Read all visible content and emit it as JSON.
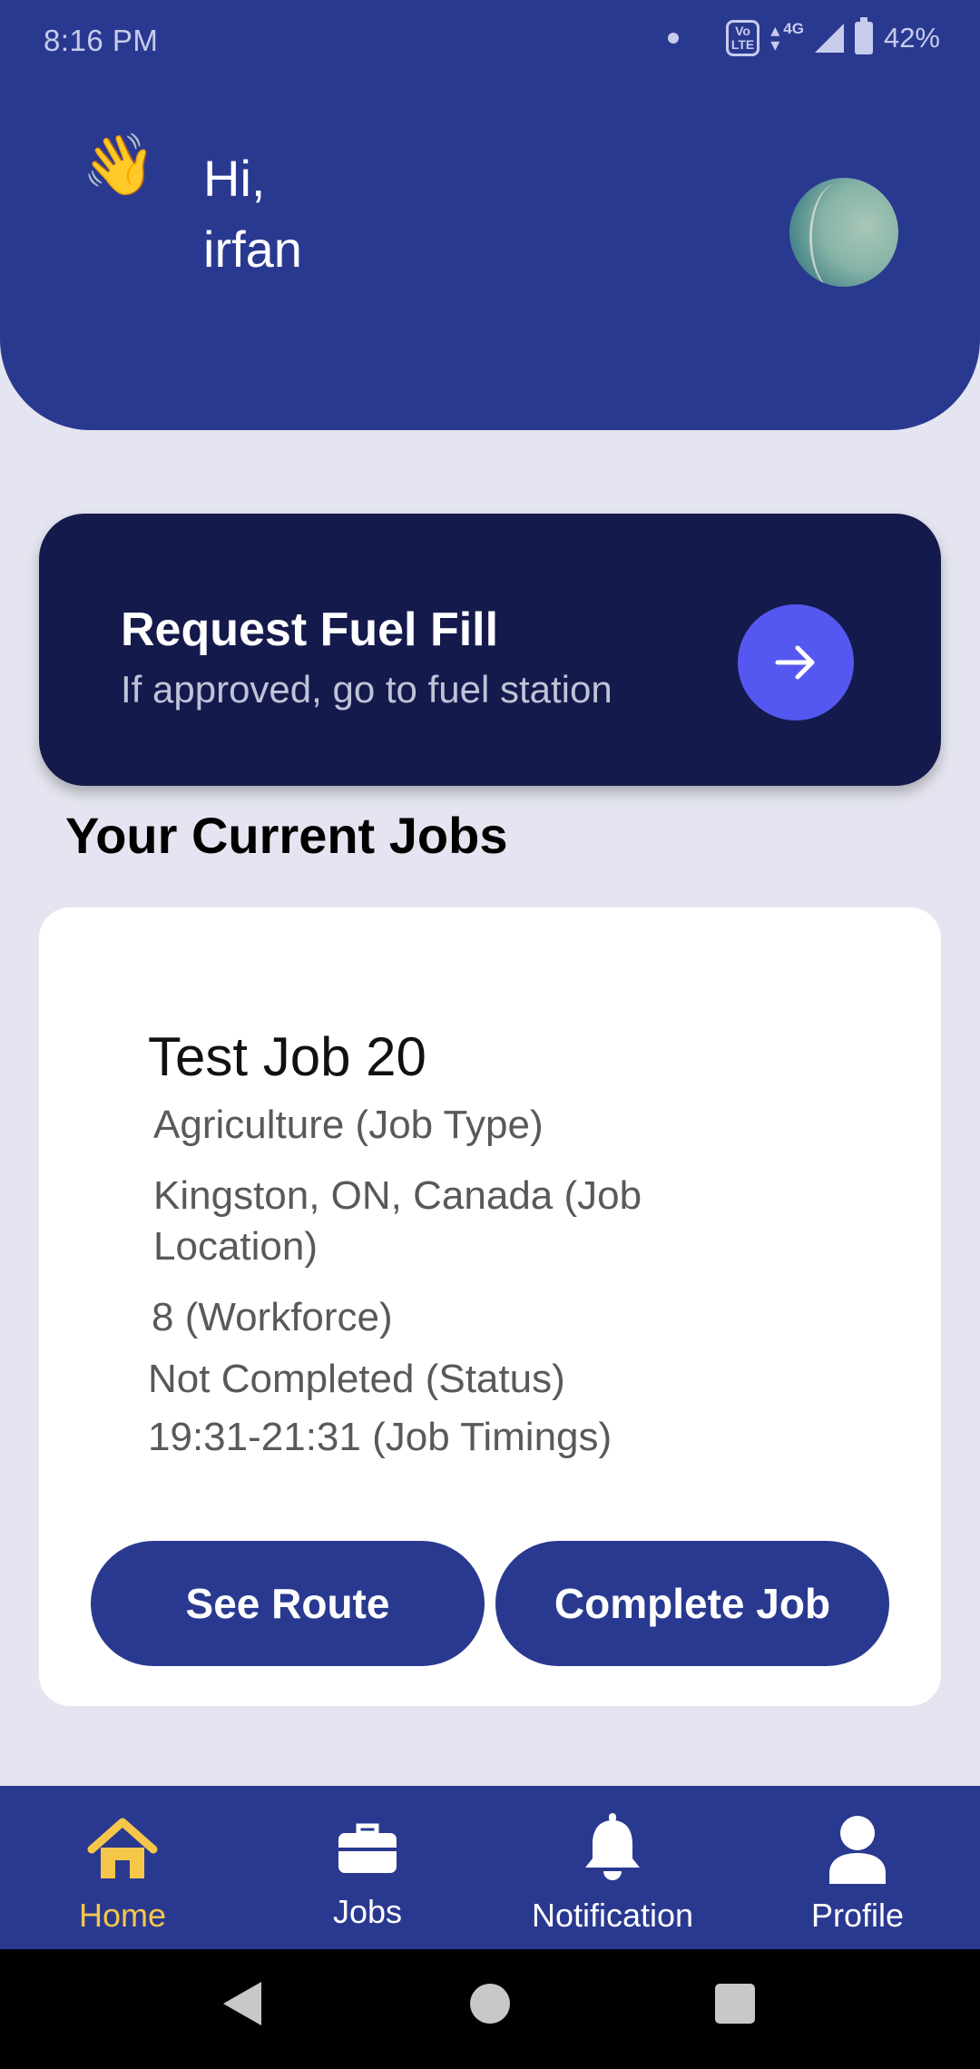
{
  "status_bar": {
    "time": "8:16 PM",
    "volte": "VoLTE",
    "network": "4G",
    "battery": "42%"
  },
  "header": {
    "wave_emoji": "👋",
    "greeting": "Hi,",
    "username": "irfan",
    "avatar_icon": "user-avatar"
  },
  "fuel_card": {
    "title": "Request Fuel Fill",
    "subtitle": "If approved, go to fuel station",
    "action_icon": "arrow-right-icon"
  },
  "section_title": "Your Current Jobs",
  "job": {
    "title": "Test Job 20",
    "job_type": "Agriculture (Job Type)",
    "location": "Kingston, ON, Canada (Job Location)",
    "workforce": "8 (Workforce)",
    "status": "Not Completed (Status)",
    "timings": "19:31-21:31 (Job Timings)",
    "see_route_label": "See Route",
    "complete_job_label": "Complete Job"
  },
  "bottom_nav": {
    "items": [
      {
        "label": "Home",
        "icon": "home-icon",
        "active": true
      },
      {
        "label": "Jobs",
        "icon": "briefcase-icon",
        "active": false
      },
      {
        "label": "Notification",
        "icon": "bell-icon",
        "active": false
      },
      {
        "label": "Profile",
        "icon": "person-icon",
        "active": false
      }
    ]
  },
  "colors": {
    "primary": "#2a3990",
    "card_dark": "#151a4c",
    "accent": "#5558f0",
    "active_nav": "#f5c64a",
    "background": "#e4e5f0"
  }
}
